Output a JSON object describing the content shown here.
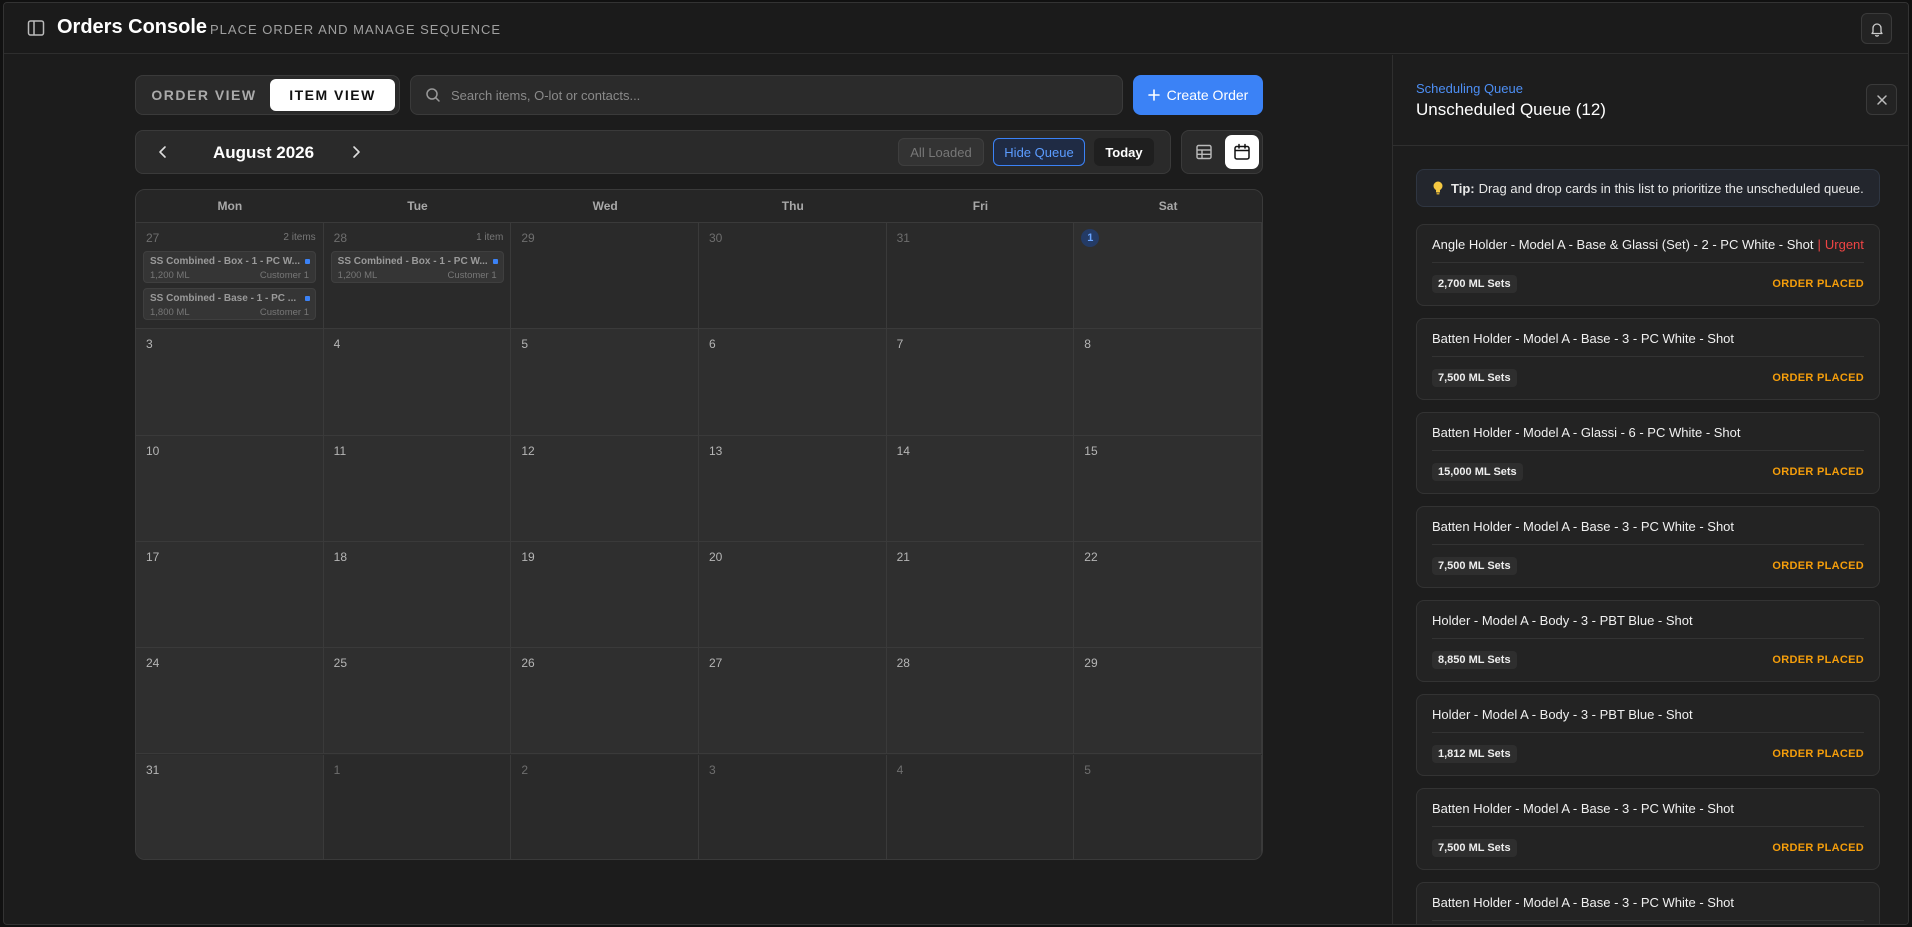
{
  "header": {
    "title": "Orders Console",
    "subtitle": "PLACE ORDER AND MANAGE SEQUENCE"
  },
  "toolbar": {
    "view_order": "ORDER VIEW",
    "view_item": "ITEM VIEW",
    "active_view": "ITEM VIEW",
    "search_placeholder": "Search items, O-lot or contacts...",
    "create_label": "Create Order"
  },
  "calendar_nav": {
    "month": "August 2026",
    "all_loaded": "All Loaded",
    "hide_queue": "Hide Queue",
    "today": "Today"
  },
  "calendar": {
    "weekdays": [
      "Mon",
      "Tue",
      "Wed",
      "Thu",
      "Fri",
      "Sat"
    ],
    "weeks": [
      [
        {
          "day": "27",
          "muted": true,
          "count": "2 items",
          "events": [
            {
              "title": "SS Combined - Box - 1 - PC W...",
              "qty": "1,200 ML",
              "customer": "Customer 1"
            },
            {
              "title": "SS Combined - Base - 1 - PC ...",
              "qty": "1,800 ML",
              "customer": "Customer 1"
            }
          ]
        },
        {
          "day": "28",
          "muted": true,
          "count": "1 item",
          "events": [
            {
              "title": "SS Combined - Box - 1 - PC W...",
              "qty": "1,200 ML",
              "customer": "Customer 1"
            }
          ]
        },
        {
          "day": "29",
          "muted": true
        },
        {
          "day": "30",
          "muted": true
        },
        {
          "day": "31",
          "muted": true
        },
        {
          "day": "1",
          "today": true
        }
      ],
      [
        {
          "day": "3"
        },
        {
          "day": "4"
        },
        {
          "day": "5"
        },
        {
          "day": "6"
        },
        {
          "day": "7"
        },
        {
          "day": "8"
        }
      ],
      [
        {
          "day": "10"
        },
        {
          "day": "11"
        },
        {
          "day": "12"
        },
        {
          "day": "13"
        },
        {
          "day": "14"
        },
        {
          "day": "15"
        }
      ],
      [
        {
          "day": "17"
        },
        {
          "day": "18"
        },
        {
          "day": "19"
        },
        {
          "day": "20"
        },
        {
          "day": "21"
        },
        {
          "day": "22"
        }
      ],
      [
        {
          "day": "24"
        },
        {
          "day": "25"
        },
        {
          "day": "26"
        },
        {
          "day": "27"
        },
        {
          "day": "28"
        },
        {
          "day": "29"
        }
      ],
      [
        {
          "day": "31"
        },
        {
          "day": "1",
          "muted": true
        },
        {
          "day": "2",
          "muted": true
        },
        {
          "day": "3",
          "muted": true
        },
        {
          "day": "4",
          "muted": true
        },
        {
          "day": "5",
          "muted": true
        }
      ]
    ]
  },
  "queue": {
    "kicker": "Scheduling Queue",
    "title": "Unscheduled Queue (12)",
    "tip_bold": "Tip:",
    "tip_text": "Drag and drop cards in this list to prioritize the unscheduled queue.",
    "items": [
      {
        "name": "Angle Holder - Model A - Base & Glassi (Set) - 2 - PC White - Shot",
        "urgent": "Urgent",
        "qty": "2,700 ML Sets",
        "status": "ORDER PLACED"
      },
      {
        "name": "Batten Holder - Model A - Base - 3 - PC White - Shot",
        "qty": "7,500 ML Sets",
        "status": "ORDER PLACED"
      },
      {
        "name": "Batten Holder - Model A - Glassi - 6 - PC White - Shot",
        "qty": "15,000 ML Sets",
        "status": "ORDER PLACED"
      },
      {
        "name": "Batten Holder - Model A - Base - 3 - PC White - Shot",
        "qty": "7,500 ML Sets",
        "status": "ORDER PLACED"
      },
      {
        "name": "Holder - Model A - Body - 3 - PBT Blue - Shot",
        "qty": "8,850 ML Sets",
        "status": "ORDER PLACED"
      },
      {
        "name": "Holder - Model A - Body - 3 - PBT Blue - Shot",
        "qty": "1,812 ML Sets",
        "status": "ORDER PLACED"
      },
      {
        "name": "Batten Holder - Model A - Base - 3 - PC White - Shot",
        "qty": "7,500 ML Sets",
        "status": "ORDER PLACED"
      },
      {
        "name": "Batten Holder - Model A - Base - 3 - PC White - Shot",
        "qty": "",
        "status": ""
      }
    ]
  },
  "colors": {
    "accent": "#3b82f6",
    "status_placed": "#f59e0b",
    "urgent": "#ef4444"
  }
}
